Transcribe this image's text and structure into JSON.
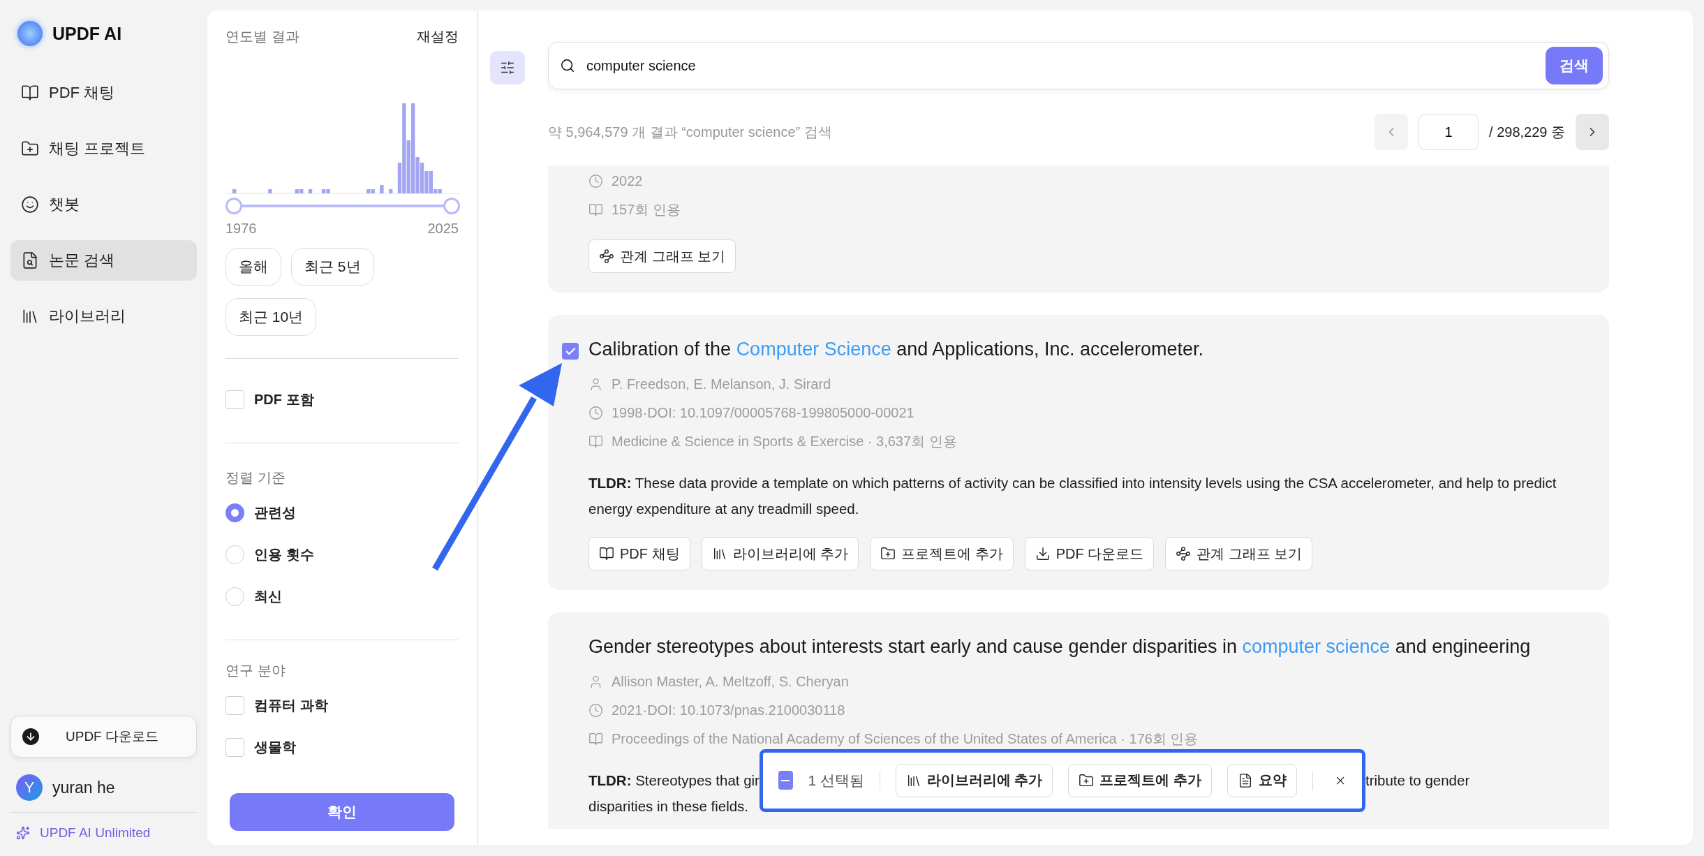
{
  "app": {
    "name": "UPDF AI"
  },
  "sidebar": {
    "items": [
      {
        "kind": "chat",
        "label": "PDF 채팅",
        "selected": false
      },
      {
        "kind": "project",
        "label": "채팅 프로젝트",
        "selected": false
      },
      {
        "kind": "bot",
        "label": "챗봇",
        "selected": false
      },
      {
        "kind": "search",
        "label": "논문 검색",
        "selected": true
      },
      {
        "kind": "library",
        "label": "라이브러리",
        "selected": false
      }
    ],
    "download_button": "UPDF 다운로드",
    "user": {
      "initial": "Y",
      "name": "yuran he"
    },
    "plan": "UPDF AI Unlimited"
  },
  "filters": {
    "year_title": "연도별 결과",
    "reset": "재설정",
    "year_range": [
      {
        "level": 0
      },
      {
        "level": 1
      }
    ],
    "year_start": "1976",
    "year_end": "2025",
    "presets": [
      "올해",
      "최근 5년",
      "최근 10년"
    ],
    "pdf_option": {
      "label": "PDF 포함",
      "checked": false
    },
    "sort": {
      "title": "정렬 기준",
      "options": [
        {
          "label": "관련성",
          "selected": true
        },
        {
          "label": "인용 횟수",
          "selected": false
        },
        {
          "label": "최신",
          "selected": false
        }
      ]
    },
    "field": {
      "title": "연구 분야",
      "options": [
        {
          "label": "컴퓨터 과학",
          "checked": false
        },
        {
          "label": "생물학",
          "checked": false
        }
      ]
    },
    "confirm": "확인"
  },
  "search": {
    "value": "computer science",
    "button": "검색"
  },
  "results": {
    "summary": "약 5,964,579 개 결과 “computer science” 검색",
    "page": "1",
    "total": "/ 298,229 중"
  },
  "papers": [
    {
      "checked": false,
      "meta": [
        {
          "kind": "date",
          "text": "2022"
        },
        {
          "kind": "source",
          "text": "157회 인용"
        }
      ],
      "actions": [
        {
          "kind": "graph",
          "label": "관계 그래프 보기"
        }
      ]
    },
    {
      "checked": true,
      "title": [
        {
          "text": "Calibration of the ",
          "highlight": false
        },
        {
          "text": "Computer Science",
          "highlight": true
        },
        {
          "text": " and Applications, Inc. accelerometer.",
          "highlight": false
        }
      ],
      "meta": [
        {
          "kind": "authors",
          "text": "P. Freedson,  E. Melanson,  J. Sirard"
        },
        {
          "kind": "date",
          "text": "1998·DOI: 10.1097/00005768-199805000-00021"
        },
        {
          "kind": "source",
          "text": "Medicine & Science in Sports & Exercise · 3,637회 인용"
        }
      ],
      "tldr": {
        "label": "TLDR:",
        "text": "These data provide a template on which patterns of activity can be classified into intensity levels using the CSA accelerometer, and help to predict energy expenditure at any treadmill speed."
      },
      "actions": [
        {
          "kind": "chat",
          "label": "PDF 채팅"
        },
        {
          "kind": "library",
          "label": "라이브러리에 추가"
        },
        {
          "kind": "project",
          "label": "프로젝트에 추가"
        },
        {
          "kind": "download",
          "label": "PDF 다운로드"
        },
        {
          "kind": "graph",
          "label": "관계 그래프 보기"
        }
      ]
    },
    {
      "checked": false,
      "title": [
        {
          "text": "Gender stereotypes about interests start early and cause gender disparities in ",
          "highlight": false
        },
        {
          "text": "computer science",
          "highlight": true
        },
        {
          "text": " and engineering",
          "highlight": false
        }
      ],
      "meta": [
        {
          "kind": "authors",
          "text": "Allison Master,  A. Meltzoff,  S. Cheryan"
        },
        {
          "kind": "date",
          "text": "2021·DOI: 10.1073/pnas.2100030118"
        },
        {
          "kind": "source",
          "text": "Proceedings of the National Academy of Sciences of the United States of America · 176회 인용"
        }
      ],
      "tldr": {
        "label": "TLDR:",
        "text": "Stereotypes that gir",
        "text_after": "tribute to gender",
        "line_2": "disparities in these fields."
      }
    }
  ],
  "selection_bar": {
    "partial": true,
    "count": "1 선택됨",
    "actions": [
      {
        "kind": "library",
        "label": "라이브러리에 추가"
      },
      {
        "kind": "project",
        "label": "프로젝트에 추가"
      },
      {
        "kind": "summary",
        "label": "요약"
      }
    ]
  }
}
